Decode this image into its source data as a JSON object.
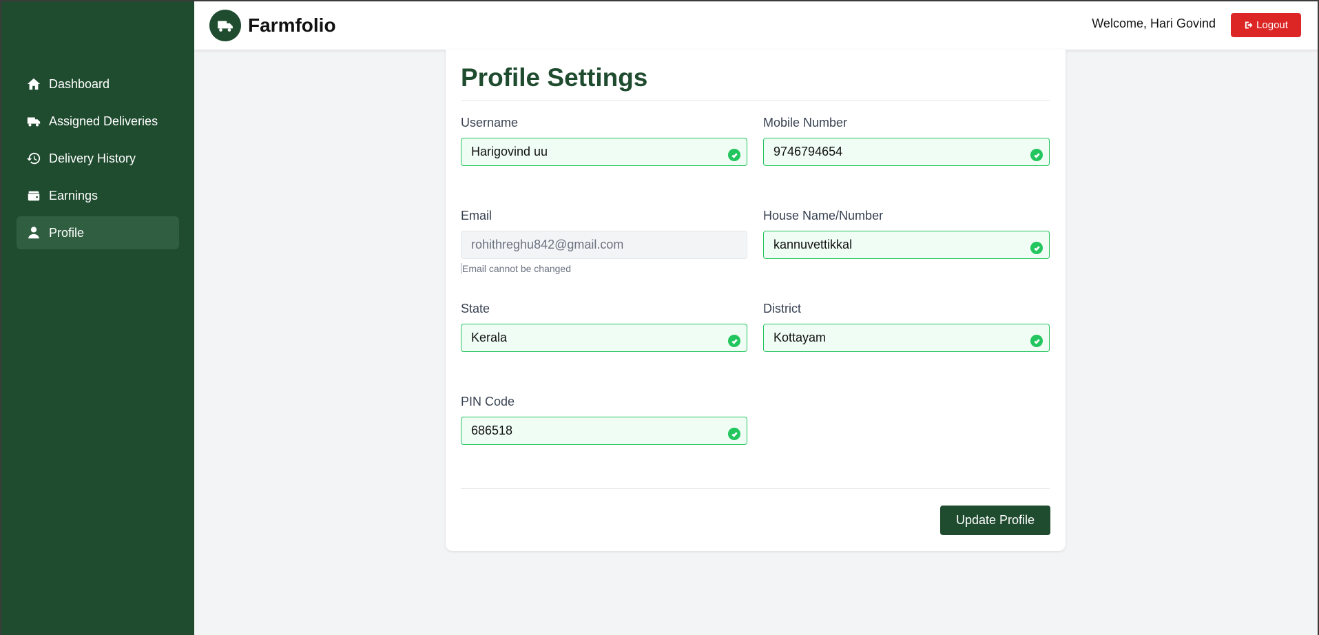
{
  "app": {
    "name": "Farmfolio"
  },
  "header": {
    "welcome": "Welcome, Hari Govind",
    "logout_label": "Logout"
  },
  "sidebar": {
    "items": [
      {
        "label": "Dashboard",
        "icon": "home-icon"
      },
      {
        "label": "Assigned Deliveries",
        "icon": "truck-icon"
      },
      {
        "label": "Delivery History",
        "icon": "history-icon"
      },
      {
        "label": "Earnings",
        "icon": "wallet-icon"
      },
      {
        "label": "Profile",
        "icon": "user-icon",
        "active": true
      }
    ]
  },
  "page": {
    "title": "Profile Settings"
  },
  "form": {
    "username": {
      "label": "Username",
      "value": "Harigovind uu"
    },
    "mobile": {
      "label": "Mobile Number",
      "value": "9746794654"
    },
    "email": {
      "label": "Email",
      "value": "rohithreghu842@gmail.com",
      "hint": "Email cannot be changed"
    },
    "house": {
      "label": "House Name/Number",
      "value": "kannuvettikkal"
    },
    "state": {
      "label": "State",
      "value": "Kerala"
    },
    "district": {
      "label": "District",
      "value": "Kottayam"
    },
    "pin": {
      "label": "PIN Code",
      "value": "686518"
    },
    "submit_label": "Update Profile"
  },
  "colors": {
    "brand": "#1f4b2f",
    "danger": "#dc2626",
    "valid": "#22c55e"
  }
}
